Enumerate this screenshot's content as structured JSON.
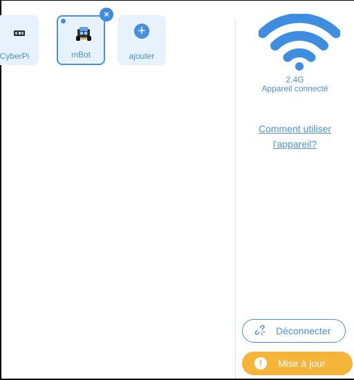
{
  "devices": [
    {
      "label": "CyberPi",
      "icon": "cyberpi-board-icon"
    },
    {
      "label": "mBot",
      "icon": "mbot-robot-icon",
      "selected": true
    },
    {
      "label": "ajouter",
      "icon": "plus-icon"
    }
  ],
  "close_glyph": "×",
  "add_glyph": "+",
  "connection": {
    "band": "2.4G",
    "status": "Appareil connecté"
  },
  "help": {
    "line1": "Comment utiliser",
    "line2": "l'appareil?"
  },
  "buttons": {
    "disconnect": "Déconnecter",
    "update": "Mise à jour",
    "update_glyph": "!"
  },
  "colors": {
    "accent": "#4a8fda",
    "warning": "#f5b43a"
  }
}
